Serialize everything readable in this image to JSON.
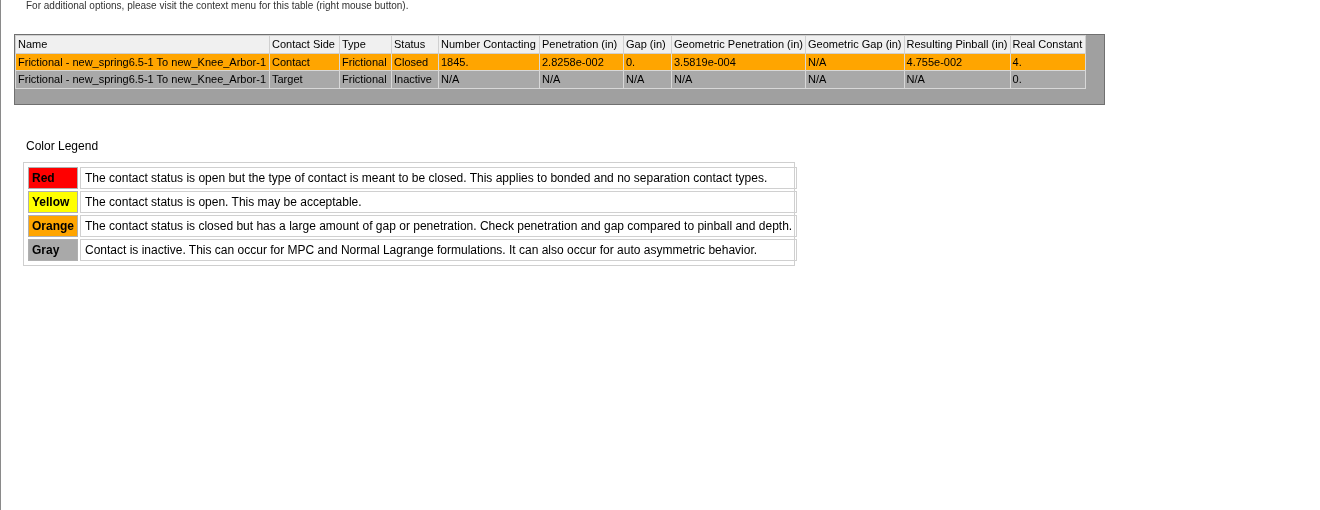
{
  "note": "For additional options, please visit the context menu for this table (right mouse button).",
  "table": {
    "columns": [
      "Name",
      "Contact Side",
      "Type",
      "Status",
      "Number Contacting",
      "Penetration (in)",
      "Gap (in)",
      "Geometric Penetration (in)",
      "Geometric Gap (in)",
      "Resulting Pinball (in)",
      "Real Constant"
    ],
    "rows": [
      {
        "color": "#ffa500",
        "cells": [
          "Frictional - new_spring6.5-1 To new_Knee_Arbor-1",
          "Contact",
          "Frictional",
          "Closed",
          "1845.",
          "2.8258e-002",
          "0.",
          "3.5819e-004",
          "N/A",
          "4.755e-002",
          "4."
        ]
      },
      {
        "color": "#a9a9a9",
        "cells": [
          "Frictional - new_spring6.5-1 To new_Knee_Arbor-1",
          "Target",
          "Frictional",
          "Inactive",
          "N/A",
          "N/A",
          "N/A",
          "N/A",
          "N/A",
          "N/A",
          "0."
        ]
      }
    ]
  },
  "legend": {
    "title": "Color Legend",
    "items": [
      {
        "label": "Red",
        "color": "#ff0000",
        "description": "The contact status is open but the type of contact is meant to be closed. This applies to bonded and no separation contact types."
      },
      {
        "label": "Yellow",
        "color": "#ffff00",
        "description": "The contact status is open. This may be acceptable."
      },
      {
        "label": "Orange",
        "color": "#ffa500",
        "description": "The contact status is closed but has a large amount of gap or penetration. Check penetration and gap compared to pinball and depth."
      },
      {
        "label": "Gray",
        "color": "#a9a9a9",
        "description": "Contact is inactive. This can occur for MPC and Normal Lagrange formulations. It can also occur for auto asymmetric behavior."
      }
    ]
  }
}
